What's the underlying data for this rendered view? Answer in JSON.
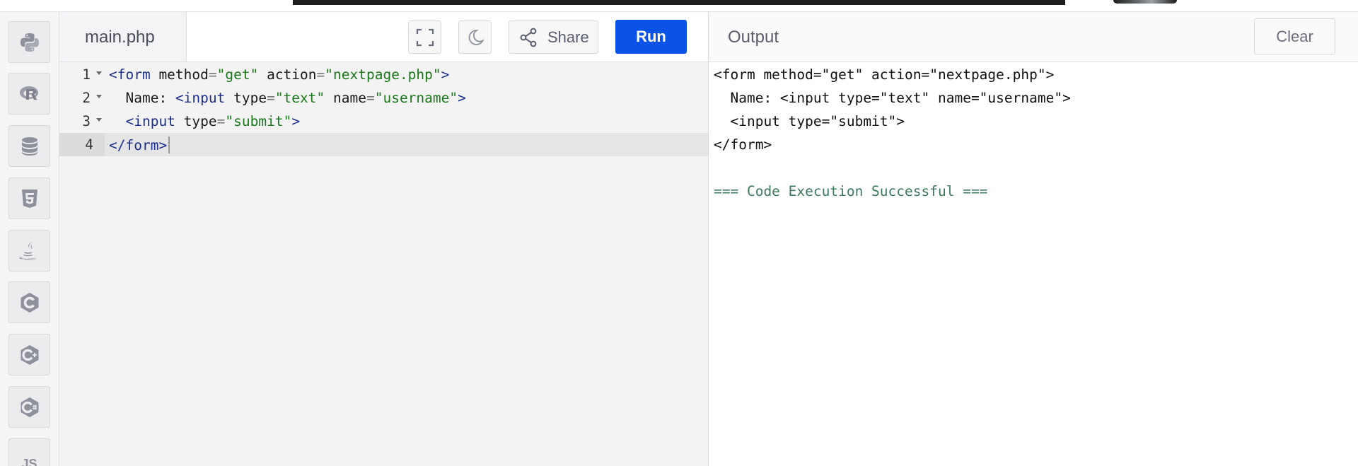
{
  "editor": {
    "filename": "main.php",
    "share_label": "Share",
    "run_label": "Run",
    "lines": [
      {
        "number": "1",
        "fold": true,
        "tokens": [
          [
            "tg",
            "<form"
          ],
          [
            "at",
            " method"
          ],
          [
            "eq",
            "="
          ],
          [
            "st",
            "\"get\""
          ],
          [
            "at",
            " action"
          ],
          [
            "eq",
            "="
          ],
          [
            "st",
            "\"nextpage.php\""
          ],
          [
            "tg",
            ">"
          ]
        ]
      },
      {
        "number": "2",
        "fold": true,
        "tokens": [
          [
            "at",
            "  Name: "
          ],
          [
            "tg",
            "<input"
          ],
          [
            "at",
            " type"
          ],
          [
            "eq",
            "="
          ],
          [
            "st",
            "\"text\""
          ],
          [
            "at",
            " name"
          ],
          [
            "eq",
            "="
          ],
          [
            "st",
            "\"username\""
          ],
          [
            "tg",
            ">"
          ]
        ]
      },
      {
        "number": "3",
        "fold": true,
        "tokens": [
          [
            "at",
            "  "
          ],
          [
            "tg",
            "<input"
          ],
          [
            "at",
            " type"
          ],
          [
            "eq",
            "="
          ],
          [
            "st",
            "\"submit\""
          ],
          [
            "tg",
            ">"
          ]
        ]
      },
      {
        "number": "4",
        "fold": false,
        "active": true,
        "tokens": [
          [
            "tg",
            "</form>"
          ]
        ]
      }
    ]
  },
  "output": {
    "title": "Output",
    "clear_label": "Clear",
    "lines": [
      "<form method=\"get\" action=\"nextpage.php\">",
      "  Name: <input type=\"text\" name=\"username\">",
      "  <input type=\"submit\">",
      "</form>",
      "",
      "=== Code Execution Successful ==="
    ]
  },
  "sidebar": {
    "languages": [
      {
        "name": "python",
        "icon": "python-icon"
      },
      {
        "name": "r",
        "icon": "r-icon"
      },
      {
        "name": "sql",
        "icon": "database-icon"
      },
      {
        "name": "html",
        "icon": "html5-icon"
      },
      {
        "name": "java",
        "icon": "java-icon"
      },
      {
        "name": "c",
        "icon": "c-icon"
      },
      {
        "name": "cpp",
        "icon": "cpp-icon"
      },
      {
        "name": "csharp",
        "icon": "csharp-icon"
      },
      {
        "name": "javascript",
        "icon": "js-icon",
        "label": "JS"
      }
    ]
  },
  "colors": {
    "run_button": "#0a53e6",
    "success_text": "#3d7a5c",
    "tag": "#1c2f8f",
    "string": "#1a7a1a"
  }
}
